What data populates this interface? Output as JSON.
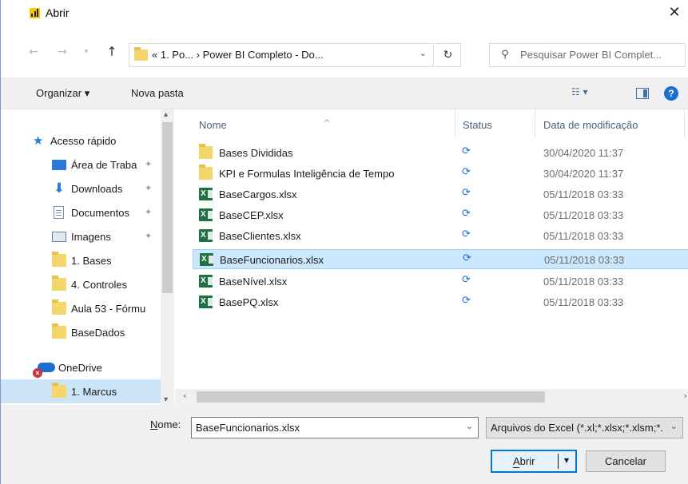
{
  "window": {
    "title": "Abrir",
    "close_glyph": "✕"
  },
  "nav": {
    "back_glyph": "←",
    "forward_glyph": "→",
    "recent_glyph": "▾",
    "up_glyph": "↑",
    "address_path": "« 1. Po... › Power BI Completo - Do...",
    "address_dropdown_glyph": "⌄",
    "refresh_glyph": "↻",
    "search_placeholder": "Pesquisar Power BI Complet..."
  },
  "toolbar": {
    "organize_label": "Organizar ▾",
    "new_folder_label": "Nova pasta",
    "view_glyph": "☷ ▾",
    "help_glyph": "?"
  },
  "navpane": {
    "items": [
      {
        "label": "Acesso rápido",
        "icon": "star-icon",
        "pinned": false
      },
      {
        "label": "Área de Traba",
        "icon": "desktop-icon",
        "pinned": true
      },
      {
        "label": "Downloads",
        "icon": "download-icon",
        "pinned": true
      },
      {
        "label": "Documentos",
        "icon": "document-icon",
        "pinned": true
      },
      {
        "label": "Imagens",
        "icon": "image-icon",
        "pinned": true
      },
      {
        "label": "1. Bases",
        "icon": "folder-icon",
        "pinned": false
      },
      {
        "label": "4. Controles",
        "icon": "folder-icon",
        "pinned": false
      },
      {
        "label": "Aula 53 - Fórmu",
        "icon": "folder-icon",
        "pinned": false
      },
      {
        "label": "BaseDados",
        "icon": "folder-icon",
        "pinned": false
      },
      {
        "label": "OneDrive",
        "icon": "onedrive-icon",
        "pinned": false
      },
      {
        "label": "1. Marcus",
        "icon": "folder-icon",
        "pinned": false
      }
    ],
    "pin_glyph": "✦"
  },
  "filelist": {
    "columns": {
      "name": "Nome",
      "status": "Status",
      "date": "Data de modificação"
    },
    "sort_glyph": "^",
    "status_glyph": "⟳",
    "files": [
      {
        "name": "Bases Divididas",
        "type": "folder",
        "date": "30/04/2020 11:37"
      },
      {
        "name": "KPI e Formulas Inteligência de Tempo",
        "type": "folder",
        "date": "30/04/2020 11:37"
      },
      {
        "name": "BaseCargos.xlsx",
        "type": "xlsx",
        "date": "05/11/2018 03:33"
      },
      {
        "name": "BaseCEP.xlsx",
        "type": "xlsx",
        "date": "05/11/2018 03:33"
      },
      {
        "name": "BaseClientes.xlsx",
        "type": "xlsx",
        "date": "05/11/2018 03:33"
      },
      {
        "name": "BaseFuncionarios.xlsx",
        "type": "xlsx",
        "date": "05/11/2018 03:33"
      },
      {
        "name": "BaseNível.xlsx",
        "type": "xlsx",
        "date": "05/11/2018 03:33"
      },
      {
        "name": "BasePQ.xlsx",
        "type": "xlsx",
        "date": "05/11/2018 03:33"
      }
    ],
    "selected_file": "BaseFuncionarios.xlsx",
    "xls_glyph": "X"
  },
  "bottom": {
    "name_label_prefix": "N",
    "name_label_rest": "ome:",
    "filename_value": "BaseFuncionarios.xlsx",
    "filetype_value": "Arquivos do Excel (*.xl;*.xlsx;*.xlsm;*.xlsb;*.xlam;*.xltx;*.xltm;*.xls;*.xla;*.xlt;*.xlm;*.xlw)",
    "dropdown_glyph": "⌄",
    "open_label": "Abrir",
    "open_caret": "▾",
    "cancel_label": "Cancelar"
  },
  "scroll": {
    "up": "▴",
    "down": "▾",
    "left": "‹",
    "right": "›"
  },
  "colors": {
    "accent": "#0078d7",
    "selection": "#cce8ff",
    "excel": "#1e7145",
    "folder": "#f5d66b"
  }
}
